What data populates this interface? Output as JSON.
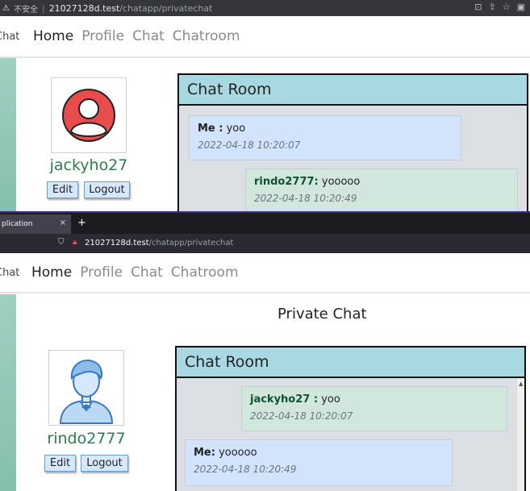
{
  "top_window": {
    "address_bar": {
      "warning_icon": "warning-icon",
      "insecure_label": "不安全",
      "separator": "|",
      "host": "21027128d.test",
      "path": "/chatapp/privatechat",
      "icons": [
        "translate-icon",
        "share-icon",
        "star-icon",
        "profile-icon"
      ]
    },
    "navbar": {
      "brand": "Chat",
      "links": [
        "Home",
        "Profile",
        "Chat",
        "Chatroom"
      ],
      "active": "Home"
    },
    "profile": {
      "avatar_icon": "user-avatar-red-icon",
      "username": "jackyho27",
      "edit_label": "Edit",
      "logout_label": "Logout"
    },
    "chat_room": {
      "title": "Chat Room",
      "messages": [
        {
          "sender": "Me :",
          "text": " yoo",
          "timestamp": "2022-04-18 10:20:07",
          "type": "me"
        },
        {
          "sender": "rindo2777:",
          "text": " yooooo",
          "timestamp": "2022-04-18 10:20:49",
          "type": "other"
        }
      ]
    }
  },
  "bottom_window": {
    "tab": {
      "title": "plication",
      "close": "×",
      "new_tab": "+"
    },
    "address_bar": {
      "host": "21027128d.test",
      "path": "/chatapp/privatechat",
      "icons": [
        "shield-icon",
        "lock-icon"
      ]
    },
    "navbar": {
      "brand": "Chat",
      "links": [
        "Home",
        "Profile",
        "Chat",
        "Chatroom"
      ],
      "active": "Home"
    },
    "page_title": "Private Chat",
    "profile": {
      "avatar_icon": "user-avatar-blue-icon",
      "username": "rindo2777",
      "edit_label": "Edit",
      "logout_label": "Logout"
    },
    "chat_room": {
      "title": "Chat Room",
      "scroll_up": "▲",
      "messages": [
        {
          "sender": "jackyho27 :",
          "text": " yoo",
          "timestamp": "2022-04-18 10:20:07",
          "type": "other"
        },
        {
          "sender": "Me:",
          "text": " yooooo",
          "timestamp": "2022-04-18 10:20:49",
          "type": "me"
        }
      ]
    }
  },
  "colors": {
    "accent_green": "#2e7d4f",
    "button_bg": "#d6e8fb",
    "header_bg": "#a8d9e3",
    "me_bubble": "#d2e3fc",
    "other_bubble": "#d1e7dd"
  }
}
